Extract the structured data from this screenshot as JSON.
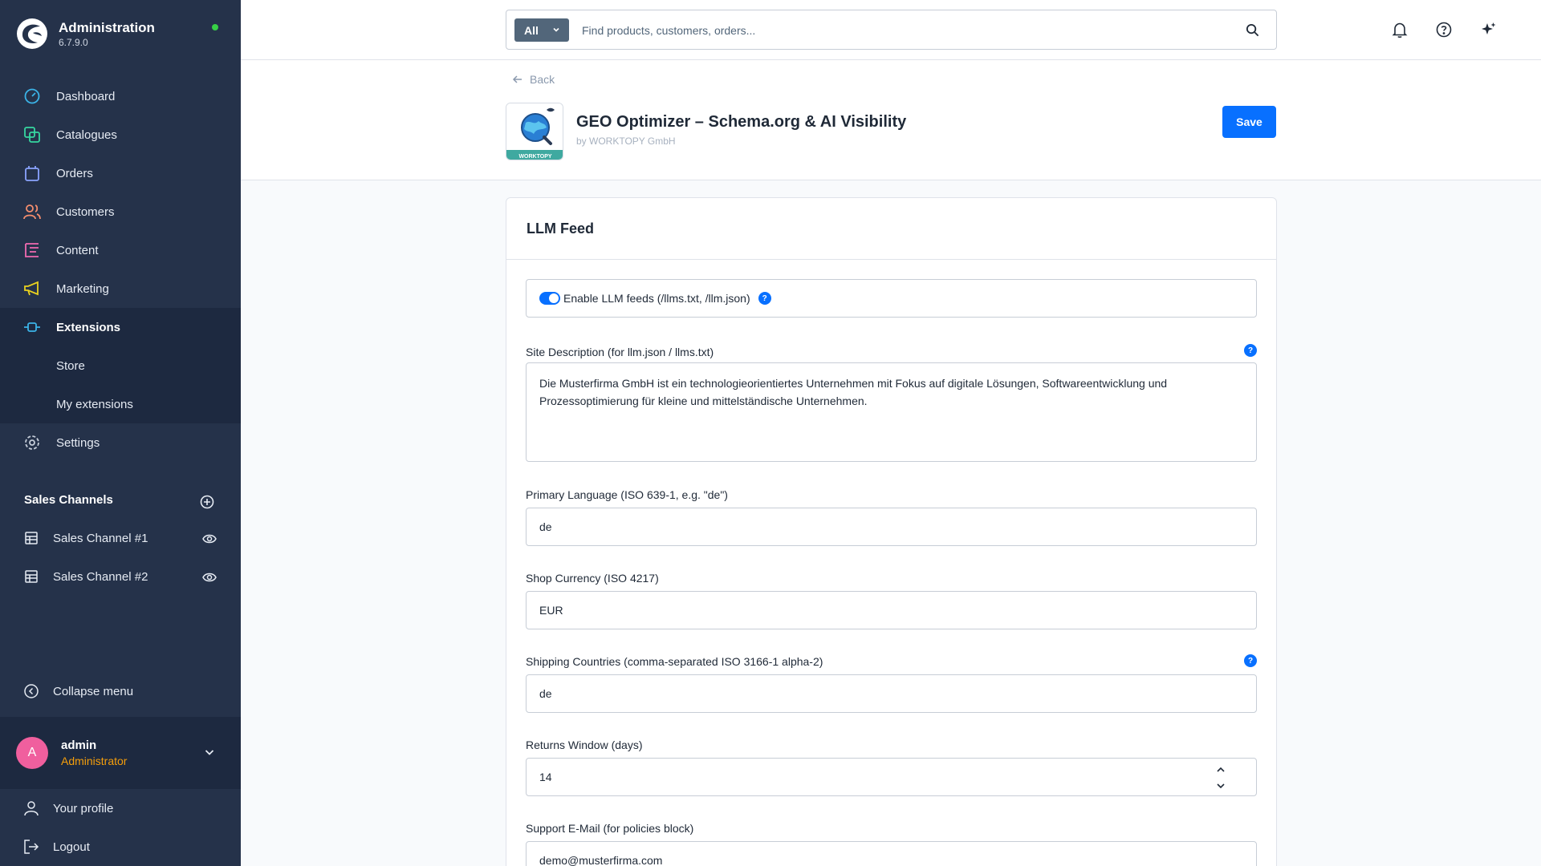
{
  "brand": {
    "title": "Administration",
    "version": "6.7.9.0"
  },
  "sidebar": {
    "items": [
      {
        "label": "Dashboard"
      },
      {
        "label": "Catalogues"
      },
      {
        "label": "Orders"
      },
      {
        "label": "Customers"
      },
      {
        "label": "Content"
      },
      {
        "label": "Marketing"
      },
      {
        "label": "Extensions"
      },
      {
        "label": "Store"
      },
      {
        "label": "My extensions"
      },
      {
        "label": "Settings"
      }
    ],
    "sales_channels_title": "Sales Channels",
    "sales_channels": [
      {
        "label": "Sales Channel #1"
      },
      {
        "label": "Sales Channel #2"
      }
    ],
    "collapse_label": "Collapse menu",
    "user": {
      "initial": "A",
      "name": "admin",
      "role": "Administrator"
    },
    "profile_label": "Your profile",
    "logout_label": "Logout"
  },
  "search": {
    "scope": "All",
    "placeholder": "Find products, customers, orders..."
  },
  "header": {
    "back_label": "Back",
    "app_title": "GEO Optimizer – Schema.org & AI Visibility",
    "app_by": "by WORKTOPY GmbH",
    "app_icon_text": "WORKTOPY",
    "save_label": "Save"
  },
  "card": {
    "title": "LLM Feed",
    "toggle_label": "Enable LLM feeds (/llms.txt, /llm.json)",
    "fields": {
      "site_description": {
        "label": "Site Description (for llm.json / llms.txt)",
        "value": "Die Musterfirma GmbH ist ein technologieorientiertes Unternehmen mit Fokus auf digitale Lösungen, Softwareentwicklung und Prozessoptimierung für kleine und mittelständische Unternehmen."
      },
      "primary_language": {
        "label": "Primary Language (ISO 639-1, e.g. \"de\")",
        "value": "de"
      },
      "shop_currency": {
        "label": "Shop Currency (ISO 4217)",
        "value": "EUR"
      },
      "shipping_countries": {
        "label": "Shipping Countries (comma-separated ISO 3166-1 alpha-2)",
        "value": "de"
      },
      "returns_window": {
        "label": "Returns Window (days)",
        "value": "14"
      },
      "support_email": {
        "label": "Support E-Mail (for policies block)",
        "value": "demo@musterfirma.com"
      }
    },
    "help_glyph": "?"
  },
  "colors": {
    "sidebar": "#25324a",
    "accent": "#0870ff",
    "status": "#37d046",
    "avatar": "#f05f9e",
    "role": "#f59e0b"
  }
}
